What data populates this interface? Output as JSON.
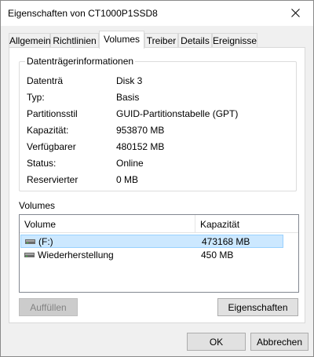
{
  "window": {
    "title": "Eigenschaften von CT1000P1SSD8"
  },
  "tabs": [
    {
      "label": "Allgemein"
    },
    {
      "label": "Richtlinien"
    },
    {
      "label": "Volumes"
    },
    {
      "label": "Treiber"
    },
    {
      "label": "Details"
    },
    {
      "label": "Ereignisse"
    }
  ],
  "active_tab": "Volumes",
  "disk_info": {
    "group_title": "Datenträgerinformationen",
    "rows": [
      {
        "label": "Datenträ",
        "value": "Disk 3"
      },
      {
        "label": "Typ:",
        "value": "Basis"
      },
      {
        "label": "Partitionsstil",
        "value": "GUID-Partitionstabelle (GPT)"
      },
      {
        "label": "Kapazität:",
        "value": "953870 MB"
      },
      {
        "label": "Verfügbarer",
        "value": "480152 MB"
      },
      {
        "label": "Status:",
        "value": "Online"
      },
      {
        "label": "Reservierter",
        "value": "0 MB"
      }
    ]
  },
  "volumes": {
    "label": "Volumes",
    "columns": [
      "Volume",
      "Kapazität"
    ],
    "rows": [
      {
        "volume": "(F:)",
        "capacity": "473168 MB",
        "selected": true
      },
      {
        "volume": "Wiederherstellung",
        "capacity": "450 MB",
        "selected": false
      }
    ]
  },
  "buttons": {
    "populate": "Auffüllen",
    "properties": "Eigenschaften",
    "ok": "OK",
    "cancel": "Abbrechen"
  },
  "icons": {
    "close": "close-icon",
    "drive": "drive-icon"
  },
  "colors": {
    "selection_bg": "#cce8ff",
    "selection_border": "#99d1ff",
    "panel_bg": "#ffffff",
    "dialog_bg": "#f0f0f0"
  }
}
